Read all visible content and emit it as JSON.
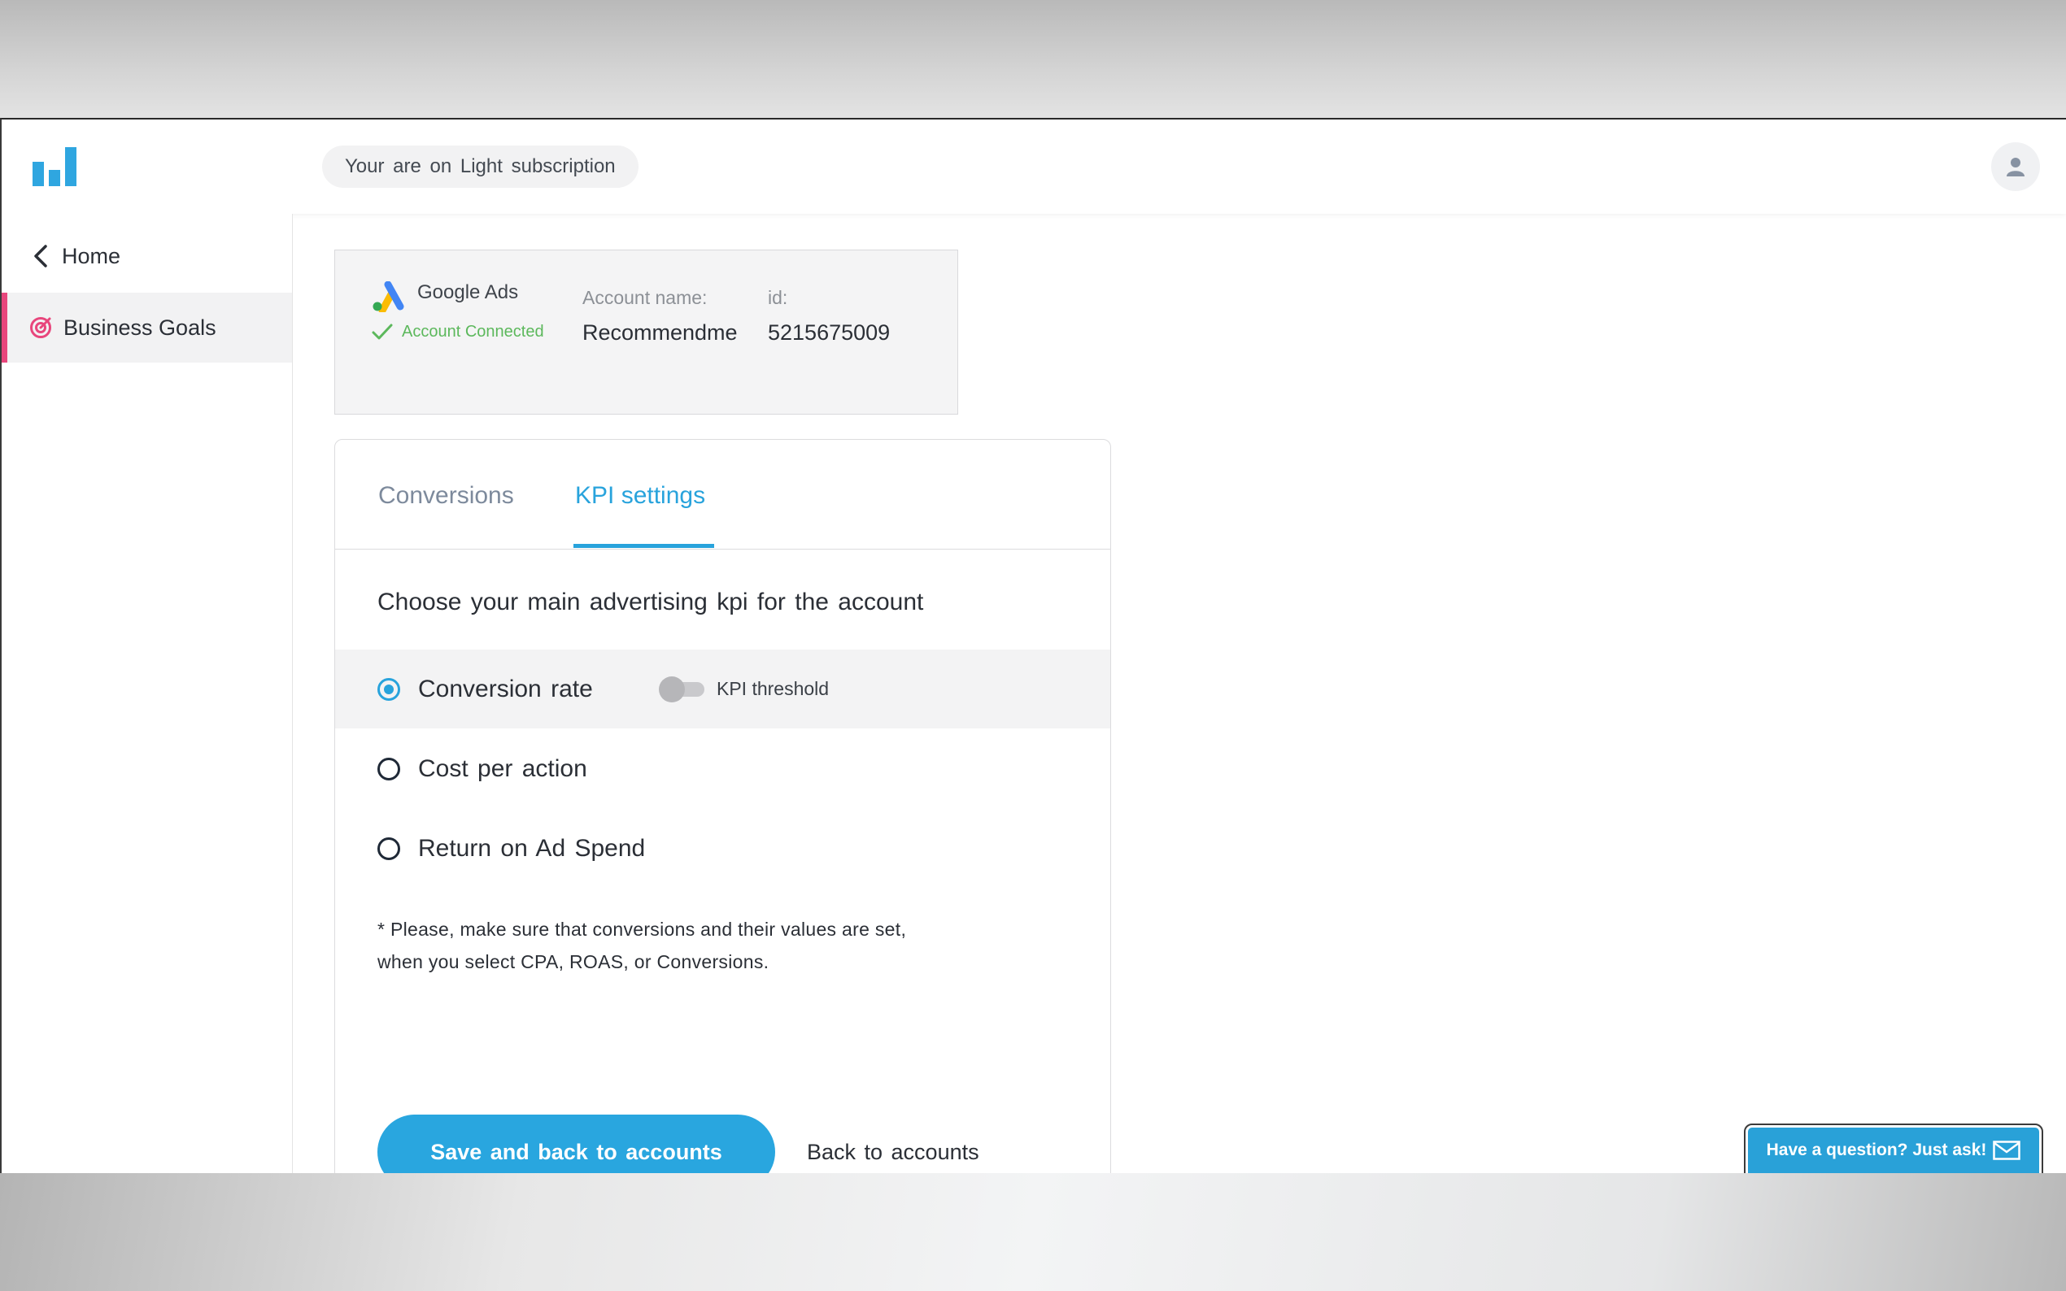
{
  "header": {
    "subscription_text": "Your are on Light subscription"
  },
  "sidebar": {
    "items": [
      {
        "label": "Home",
        "icon": "chevron-left-icon"
      },
      {
        "label": "Business Goals",
        "icon": "target-icon",
        "active": true
      }
    ]
  },
  "account": {
    "platform": "Google Ads",
    "status": "Account Connected",
    "name_label": "Account name:",
    "name_value": "Recommendme",
    "id_label": "id:",
    "id_value": "5215675009"
  },
  "tabs": [
    {
      "label": "Conversions",
      "active": false
    },
    {
      "label": "KPI settings",
      "active": true
    }
  ],
  "kpi": {
    "heading": "Choose your main advertising kpi for the account",
    "options": [
      {
        "label": "Conversion rate",
        "selected": true
      },
      {
        "label": "Cost per action",
        "selected": false
      },
      {
        "label": "Return on Ad Spend",
        "selected": false
      }
    ],
    "threshold_label": "KPI threshold",
    "threshold_on": false,
    "note_line1": "* Please, make sure that conversions and their values are set,",
    "note_line2": "when you select CPA, ROAS, or Conversions."
  },
  "actions": {
    "save_label": "Save and back to accounts",
    "back_label": "Back to accounts"
  },
  "chat": {
    "label": "Have a question? Just ask!"
  },
  "colors": {
    "accent": "#28a3dc",
    "active_marker": "#e8467c",
    "connected": "#5cb85c"
  }
}
